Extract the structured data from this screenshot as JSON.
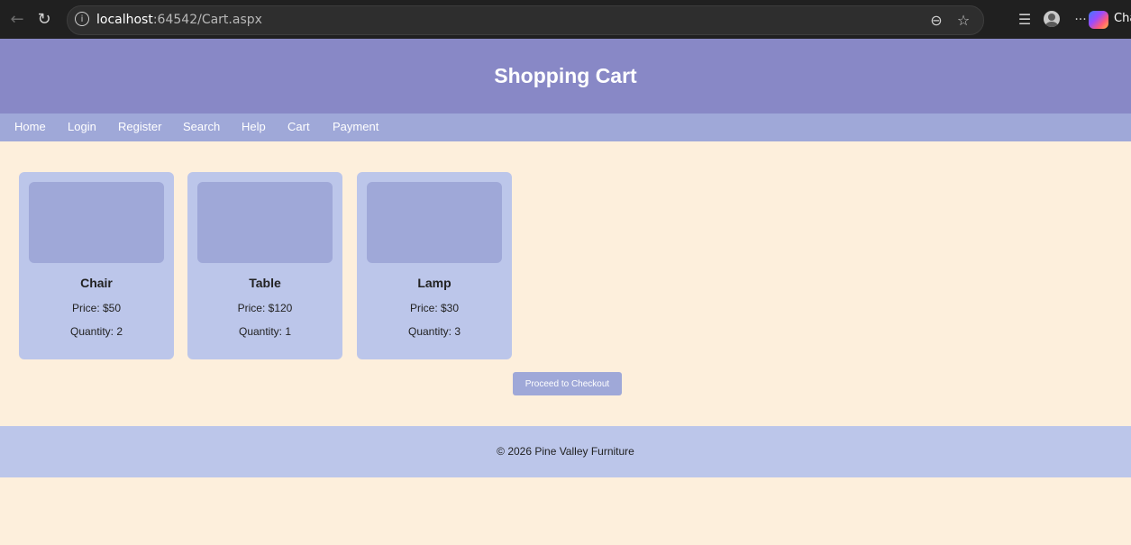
{
  "browser": {
    "url_host": "localhost",
    "url_rest": ":64542/Cart.aspx",
    "copilot_label": "Cha",
    "icons": [
      "back-icon",
      "reload-icon",
      "info-icon",
      "zoom-out-icon",
      "star-icon",
      "favorites-icon",
      "profile-icon",
      "more-icon",
      "copilot-icon"
    ]
  },
  "header": {
    "title": "Shopping Cart"
  },
  "nav": {
    "items": [
      {
        "label": "Home"
      },
      {
        "label": "Login"
      },
      {
        "label": "Register"
      },
      {
        "label": "Search"
      },
      {
        "label": "Help"
      },
      {
        "label": "Cart"
      },
      {
        "label": "Payment"
      }
    ]
  },
  "cart": {
    "items": [
      {
        "name": "Chair",
        "price": "Price: $50",
        "quantity": "Quantity: 2"
      },
      {
        "name": "Table",
        "price": "Price: $120",
        "quantity": "Quantity: 1"
      },
      {
        "name": "Lamp",
        "price": "Price: $30",
        "quantity": "Quantity: 3"
      }
    ],
    "checkout_label": "Proceed to Checkout"
  },
  "footer": {
    "text": "© 2026 Pine Valley Furniture"
  },
  "colors": {
    "background": "#fdefdc",
    "header": "#8888c6",
    "nav": "#9fa8d8",
    "card": "#bcc6ea",
    "footer": "#bcc6ea"
  }
}
